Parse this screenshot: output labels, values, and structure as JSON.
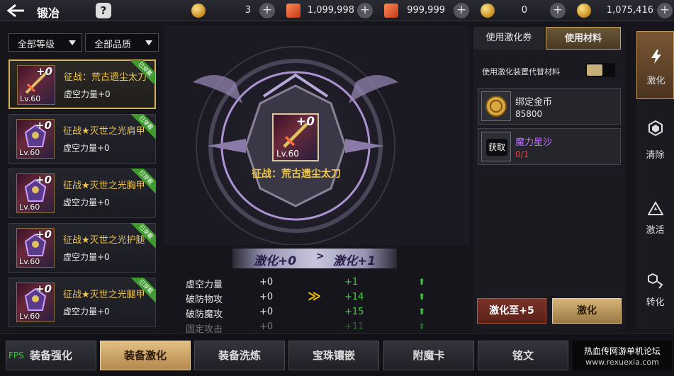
{
  "header": {
    "title": "锻冶",
    "help_label": "?",
    "resources": [
      {
        "icon": "gold-coin-icon",
        "value": "3"
      },
      {
        "icon": "scroll-ticket-icon",
        "value": "1,099,998"
      },
      {
        "icon": "scroll-ticket-icon",
        "value": "999,999"
      },
      {
        "icon": "gold-coin-icon",
        "value": "0"
      },
      {
        "icon": "bound-gold-coin-icon",
        "value": "1,075,416"
      }
    ],
    "plus_label": "+"
  },
  "filters": {
    "level": "全部等级",
    "quality": "全部品质"
  },
  "equipment_list": [
    {
      "name": "征战：荒古遗尘太刀",
      "stat": "虚空力量+0",
      "level": "Lv.60",
      "enhance": "+0",
      "badge": "已穿戴",
      "selected": true
    },
    {
      "name": "征战★灭世之光肩甲",
      "stat": "虚空力量+0",
      "level": "Lv.60",
      "enhance": "+0",
      "badge": "已穿戴",
      "selected": false
    },
    {
      "name": "征战★灭世之光胸甲",
      "stat": "虚空力量+0",
      "level": "Lv.60",
      "enhance": "+0",
      "badge": "已穿戴",
      "selected": false
    },
    {
      "name": "征战★灭世之光护腿",
      "stat": "虚空力量+0",
      "level": "Lv.60",
      "enhance": "+0",
      "badge": "已穿戴",
      "selected": false
    },
    {
      "name": "征战★灭世之光腿甲",
      "stat": "虚空力量+0",
      "level": "Lv.60",
      "enhance": "+0",
      "badge": "已穿戴",
      "selected": false
    }
  ],
  "center": {
    "item_enhance": "+0",
    "item_level": "Lv.60",
    "item_name": "征战：荒古遗尘太刀",
    "from_label": "激化+0",
    "to_label": "激化+1",
    "arrow": ">",
    "chevrons": "≫",
    "stats": [
      {
        "name": "虚空力量",
        "current": "+0",
        "delta": "+1",
        "up": "⬆"
      },
      {
        "name": "破防物攻",
        "current": "+0",
        "delta": "+14",
        "up": "⬆"
      },
      {
        "name": "破防魔攻",
        "current": "+0",
        "delta": "+15",
        "up": "⬆"
      },
      {
        "name": "固定攻击",
        "current": "+0",
        "delta": "+11",
        "up": "⬆"
      }
    ]
  },
  "right_panel": {
    "tab_voucher": "使用激化券",
    "tab_material": "使用材料",
    "option_label": "使用激化装置代替材料",
    "materials": [
      {
        "name": "绑定金币",
        "value": "85800",
        "name_color": "#e6e6e6",
        "value_color": "#e6e6e6"
      },
      {
        "name": "魔力星沙",
        "value": "0/1",
        "name_color": "#c070ff",
        "value_color": "#e84040",
        "action": "获取"
      }
    ],
    "btn_to5": "激化至+5",
    "btn_enhance": "激化"
  },
  "side_tabs": [
    {
      "label": "激化",
      "icon": "lightning-icon",
      "active": true
    },
    {
      "label": "清除",
      "icon": "hexagon-icon",
      "active": false
    },
    {
      "label": "激活",
      "icon": "triangle-star-icon",
      "active": false
    },
    {
      "label": "转化",
      "icon": "convert-icon",
      "active": false
    }
  ],
  "bottom_tabs": [
    {
      "label": "装备强化",
      "active": false
    },
    {
      "label": "装备激化",
      "active": true
    },
    {
      "label": "装备洗炼",
      "active": false
    },
    {
      "label": "宝珠镶嵌",
      "active": false
    },
    {
      "label": "附魔卡",
      "active": false
    },
    {
      "label": "铭文",
      "active": false
    }
  ],
  "overlay": {
    "fps": "FPS",
    "watermark_line1": "热血传网游单机论坛",
    "watermark_line2": "www.rexuexia.com"
  }
}
